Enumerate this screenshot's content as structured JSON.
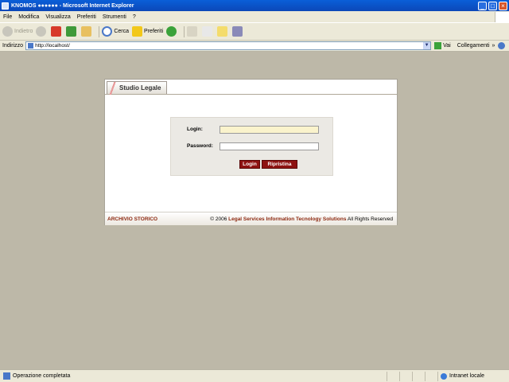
{
  "window": {
    "title": "KNOMOS ●●●●●● - Microsoft Internet Explorer"
  },
  "menu": [
    "File",
    "Modifica",
    "Visualizza",
    "Preferiti",
    "Strumenti",
    "?"
  ],
  "toolbar": {
    "back": "Indietro",
    "search": "Cerca",
    "favorites": "Preferiti"
  },
  "address": {
    "label": "Indirizzo",
    "url": "http://localhost/",
    "go": "Vai",
    "links": "Collegamenti",
    "chevron": "»"
  },
  "page": {
    "header_title": "Studio Legale",
    "login_label": "Login:",
    "password_label": "Password:",
    "login_value": "",
    "password_value": "",
    "login_button": "Login",
    "reset_button": "Ripristina",
    "footer_left": "ARCHIVIO STORICO",
    "footer_copy": "© 2006",
    "footer_org": "Legal Services Information Tecnology Solutions",
    "footer_rights": "All Rights Reserved"
  },
  "status": {
    "text": "Operazione completata",
    "zone": "Intranet locale"
  },
  "colors": {
    "titlebar": "#0b47b8",
    "chrome": "#ece9d8",
    "page_background": "#bdb8a8",
    "accent_button": "#8e1212",
    "footer_accent": "#8e2a12",
    "active_input": "#faf3cc"
  }
}
